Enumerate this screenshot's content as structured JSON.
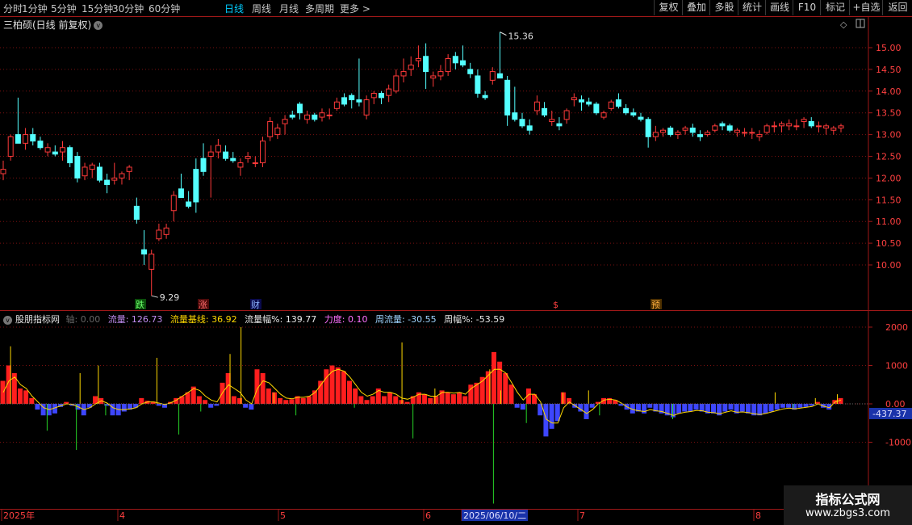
{
  "toolbar": {
    "left": [
      {
        "label": "分时",
        "active": false
      },
      {
        "label": "1分钟",
        "active": false
      },
      {
        "label": "5分钟",
        "active": false
      },
      {
        "label": "15分钟",
        "active": false
      },
      {
        "label": "30分钟",
        "active": false
      },
      {
        "label": "60分钟",
        "active": false
      },
      {
        "label": "日线",
        "active": true
      },
      {
        "label": "周线",
        "active": false
      },
      {
        "label": "月线",
        "active": false
      },
      {
        "label": "多周期",
        "active": false
      },
      {
        "label": "更多 >",
        "active": false
      }
    ],
    "right": [
      "复权",
      "叠加",
      "多股",
      "统计",
      "画线",
      "F10",
      "标记",
      "+自选",
      "返回"
    ]
  },
  "chart_title": "三柏硕(日线 前复权)",
  "price_axis": {
    "labels": [
      "15.00",
      "14.50",
      "14.00",
      "13.50",
      "13.00",
      "12.50",
      "12.00",
      "11.50",
      "11.00",
      "10.50",
      "10.00"
    ],
    "ylim": [
      9.29,
      15.36
    ]
  },
  "annotations": {
    "high": "15.36",
    "low": "9.29"
  },
  "event_markers": [
    "跌",
    "涨",
    "财",
    "$",
    "预"
  ],
  "indicator": {
    "name": "股朋指标网",
    "axis": {
      "label": "轴",
      "value": "0.00"
    },
    "flow": {
      "label": "流量",
      "value": "126.73"
    },
    "base": {
      "label": "流量基线",
      "value": "36.92"
    },
    "amp": {
      "label": "流量幅%",
      "value": "139.77"
    },
    "force": {
      "label": "力度",
      "value": "0.10"
    },
    "wflow": {
      "label": "周流量",
      "value": "-30.55"
    },
    "wamp": {
      "label": "周幅%",
      "value": "-53.59"
    },
    "axis_labels": [
      "2000",
      "1000",
      "0.00",
      "-1000"
    ],
    "current_value": "-437.37"
  },
  "date_axis": {
    "labels": [
      "2025年",
      "4",
      "5",
      "6",
      "2025/06/10/二",
      "7",
      "8"
    ]
  },
  "watermark": {
    "title": "指标公式网",
    "url": "www.zbgs3.com"
  },
  "colors": {
    "up": "#ff3a3a",
    "down": "#54ffff",
    "pos_bar": "#ff1e1e",
    "neg_bar": "#3d46ff",
    "grid": "#7a1010",
    "frame": "#a01818",
    "base_line": "#ffd900",
    "spike": "#27d227"
  },
  "chart_data": {
    "type": "candlestick",
    "price_ylim": [
      9.29,
      15.36
    ],
    "candles": [
      [
        12.1,
        12.4,
        11.95,
        12.2
      ],
      [
        12.5,
        13.0,
        12.4,
        12.95
      ],
      [
        13.0,
        13.85,
        12.8,
        12.8
      ],
      [
        12.8,
        13.15,
        12.65,
        13.0
      ],
      [
        13.0,
        13.15,
        12.75,
        12.85
      ],
      [
        12.85,
        12.95,
        12.65,
        12.7
      ],
      [
        12.6,
        12.8,
        12.5,
        12.7
      ],
      [
        12.6,
        12.75,
        12.5,
        12.55
      ],
      [
        12.6,
        12.85,
        12.4,
        12.7
      ],
      [
        12.7,
        12.75,
        12.25,
        12.35
      ],
      [
        12.5,
        12.6,
        11.9,
        12.0
      ],
      [
        12.05,
        12.35,
        11.95,
        12.25
      ],
      [
        12.2,
        12.35,
        12.0,
        12.3
      ],
      [
        12.25,
        12.35,
        11.9,
        11.95
      ],
      [
        11.95,
        12.1,
        11.65,
        11.85
      ],
      [
        11.95,
        12.35,
        11.85,
        12.0
      ],
      [
        12.0,
        12.15,
        11.85,
        12.1
      ],
      [
        12.15,
        12.3,
        11.95,
        12.25
      ],
      [
        11.35,
        11.55,
        10.95,
        11.05
      ],
      [
        10.35,
        10.8,
        10.0,
        10.25
      ],
      [
        9.9,
        10.35,
        9.29,
        10.25
      ],
      [
        10.6,
        10.95,
        10.55,
        10.8
      ],
      [
        10.7,
        10.95,
        10.6,
        10.85
      ],
      [
        11.25,
        11.7,
        11.0,
        11.6
      ],
      [
        11.75,
        12.1,
        11.6,
        11.55
      ],
      [
        11.45,
        11.7,
        11.3,
        11.35
      ],
      [
        12.2,
        12.45,
        11.2,
        11.45
      ],
      [
        12.45,
        12.8,
        12.05,
        12.15
      ],
      [
        12.5,
        12.75,
        11.55,
        12.6
      ],
      [
        12.6,
        12.9,
        12.45,
        12.75
      ],
      [
        12.6,
        12.75,
        12.4,
        12.45
      ],
      [
        12.45,
        12.6,
        12.35,
        12.4
      ],
      [
        12.25,
        12.45,
        12.05,
        12.35
      ],
      [
        12.45,
        12.6,
        12.35,
        12.5
      ],
      [
        12.35,
        12.5,
        12.25,
        12.35
      ],
      [
        12.35,
        12.95,
        12.25,
        12.85
      ],
      [
        12.95,
        13.4,
        12.85,
        13.3
      ],
      [
        13.0,
        13.25,
        12.9,
        13.15
      ],
      [
        13.25,
        13.45,
        13.0,
        13.35
      ],
      [
        13.45,
        13.55,
        13.35,
        13.4
      ],
      [
        13.7,
        13.75,
        13.35,
        13.5
      ],
      [
        13.35,
        13.55,
        13.25,
        13.45
      ],
      [
        13.45,
        13.5,
        13.3,
        13.35
      ],
      [
        13.4,
        13.6,
        13.3,
        13.5
      ],
      [
        13.45,
        13.6,
        13.35,
        13.45
      ],
      [
        13.6,
        13.85,
        13.55,
        13.75
      ],
      [
        13.85,
        13.95,
        13.65,
        13.7
      ],
      [
        13.9,
        13.95,
        13.6,
        13.8
      ],
      [
        13.8,
        14.75,
        13.65,
        13.75
      ],
      [
        13.45,
        13.9,
        13.35,
        13.8
      ],
      [
        13.85,
        14.0,
        13.7,
        13.95
      ],
      [
        13.95,
        14.0,
        13.7,
        13.85
      ],
      [
        13.9,
        14.15,
        13.75,
        14.05
      ],
      [
        14.0,
        14.5,
        13.95,
        14.35
      ],
      [
        14.35,
        14.75,
        14.2,
        14.45
      ],
      [
        14.5,
        14.8,
        14.35,
        14.6
      ],
      [
        14.7,
        15.05,
        14.55,
        14.75
      ],
      [
        14.8,
        15.1,
        14.05,
        14.45
      ],
      [
        14.3,
        14.45,
        14.1,
        14.35
      ],
      [
        14.35,
        14.6,
        14.25,
        14.45
      ],
      [
        14.45,
        14.85,
        14.35,
        14.75
      ],
      [
        14.8,
        14.9,
        14.5,
        14.65
      ],
      [
        14.7,
        15.05,
        14.55,
        14.6
      ],
      [
        14.5,
        14.65,
        14.3,
        14.4
      ],
      [
        14.35,
        14.5,
        13.85,
        13.95
      ],
      [
        13.9,
        14.0,
        13.8,
        13.85
      ],
      [
        14.25,
        14.55,
        14.15,
        14.45
      ],
      [
        14.4,
        15.36,
        14.3,
        14.3
      ],
      [
        14.25,
        14.35,
        13.2,
        13.45
      ],
      [
        13.5,
        14.1,
        13.3,
        13.35
      ],
      [
        13.35,
        13.5,
        13.15,
        13.2
      ],
      [
        13.2,
        13.35,
        13.0,
        13.1
      ],
      [
        13.55,
        13.9,
        13.45,
        13.75
      ],
      [
        13.6,
        13.75,
        13.4,
        13.45
      ],
      [
        13.3,
        13.55,
        13.2,
        13.35
      ],
      [
        13.25,
        13.4,
        13.1,
        13.2
      ],
      [
        13.35,
        13.6,
        13.25,
        13.55
      ],
      [
        13.8,
        13.95,
        13.65,
        13.85
      ],
      [
        13.8,
        13.9,
        13.55,
        13.75
      ],
      [
        13.75,
        13.85,
        13.65,
        13.7
      ],
      [
        13.7,
        13.75,
        13.45,
        13.5
      ],
      [
        13.4,
        13.55,
        13.35,
        13.5
      ],
      [
        13.6,
        13.8,
        13.55,
        13.75
      ],
      [
        13.8,
        13.95,
        13.6,
        13.65
      ],
      [
        13.6,
        13.7,
        13.45,
        13.5
      ],
      [
        13.5,
        13.6,
        13.4,
        13.45
      ],
      [
        13.4,
        13.5,
        13.3,
        13.35
      ],
      [
        13.35,
        13.4,
        12.7,
        12.95
      ],
      [
        12.95,
        13.2,
        12.85,
        13.05
      ],
      [
        13.05,
        13.15,
        12.95,
        13.1
      ],
      [
        13.15,
        13.2,
        12.95,
        13.0
      ],
      [
        13.0,
        13.1,
        12.9,
        13.05
      ],
      [
        13.1,
        13.2,
        13.0,
        13.15
      ],
      [
        13.15,
        13.25,
        12.95,
        13.05
      ],
      [
        13.0,
        13.1,
        12.85,
        12.95
      ],
      [
        13.0,
        13.1,
        12.95,
        13.05
      ],
      [
        13.1,
        13.25,
        13.05,
        13.2
      ],
      [
        13.25,
        13.3,
        13.1,
        13.2
      ],
      [
        13.2,
        13.25,
        13.05,
        13.1
      ],
      [
        13.05,
        13.15,
        12.95,
        13.1
      ],
      [
        13.05,
        13.15,
        12.95,
        13.05
      ],
      [
        13.05,
        13.15,
        12.9,
        13.05
      ],
      [
        12.95,
        13.1,
        12.85,
        13.0
      ],
      [
        13.05,
        13.25,
        13.0,
        13.2
      ],
      [
        13.2,
        13.3,
        13.05,
        13.2
      ],
      [
        13.2,
        13.3,
        13.05,
        13.25
      ],
      [
        13.2,
        13.35,
        13.1,
        13.25
      ],
      [
        13.2,
        13.35,
        13.1,
        13.2
      ],
      [
        13.3,
        13.4,
        13.15,
        13.35
      ],
      [
        13.3,
        13.4,
        13.15,
        13.2
      ],
      [
        13.2,
        13.3,
        13.05,
        13.2
      ],
      [
        13.15,
        13.25,
        13.0,
        13.2
      ],
      [
        13.1,
        13.2,
        13.0,
        13.15
      ],
      [
        13.15,
        13.25,
        13.05,
        13.2
      ]
    ],
    "flow_ylim": [
      -2500,
      2500
    ],
    "flow_bars": [
      600,
      1000,
      800,
      400,
      350,
      150,
      -150,
      -300,
      -300,
      -250,
      -80,
      50,
      -50,
      -150,
      -300,
      -100,
      200,
      150,
      -50,
      -300,
      -300,
      -200,
      -150,
      -100,
      150,
      80,
      60,
      -50,
      -100,
      50,
      150,
      200,
      300,
      450,
      200,
      100,
      -100,
      -50,
      550,
      800,
      200,
      150,
      -100,
      -150,
      900,
      800,
      400,
      300,
      150,
      100,
      120,
      200,
      150,
      200,
      350,
      600,
      900,
      1000,
      950,
      850,
      600,
      400,
      200,
      100,
      200,
      400,
      200,
      300,
      200,
      100,
      50,
      200,
      300,
      250,
      150,
      200,
      350,
      300,
      250,
      300,
      200,
      500,
      550,
      700,
      850,
      1350,
      1100,
      800,
      500,
      -100,
      -150,
      400,
      250,
      -300,
      -850,
      -650,
      -450,
      300,
      150,
      -100,
      -200,
      -400,
      -100,
      50,
      150,
      150,
      100,
      -50,
      -150,
      -250,
      -200,
      -250,
      -100,
      -200,
      -250,
      -300,
      -350,
      -250,
      -200,
      -200,
      -150,
      -200,
      -250,
      -250,
      -300,
      -200,
      -150,
      -250,
      -200,
      -250,
      -300,
      -300,
      -250,
      -200,
      -150,
      -100,
      -100,
      -150,
      -100,
      -80,
      -50,
      50,
      -100,
      -150,
      100,
      150
    ],
    "base_line": [
      300,
      600,
      700,
      500,
      400,
      200,
      50,
      -100,
      -150,
      -100,
      -50,
      0,
      -20,
      -80,
      -150,
      -100,
      0,
      80,
      20,
      -100,
      -150,
      -150,
      -130,
      -100,
      0,
      50,
      50,
      20,
      -20,
      30,
      100,
      200,
      300,
      400,
      350,
      200,
      100,
      50,
      300,
      500,
      400,
      300,
      100,
      0,
      400,
      600,
      550,
      400,
      250,
      150,
      130,
      170,
      170,
      200,
      300,
      500,
      700,
      850,
      900,
      850,
      700,
      500,
      300,
      200,
      250,
      350,
      300,
      300,
      250,
      150,
      120,
      180,
      250,
      250,
      200,
      200,
      300,
      300,
      280,
      300,
      250,
      400,
      500,
      600,
      750,
      900,
      900,
      800,
      550,
      300,
      100,
      250,
      250,
      50,
      -400,
      -500,
      -500,
      -100,
      50,
      -50,
      -150,
      -250,
      -150,
      0,
      100,
      120,
      100,
      20,
      -80,
      -150,
      -180,
      -200,
      -150,
      -180,
      -200,
      -250,
      -300,
      -250,
      -220,
      -200,
      -170,
      -180,
      -220,
      -230,
      -260,
      -220,
      -180,
      -220,
      -210,
      -230,
      -260,
      -280,
      -250,
      -210,
      -170,
      -130,
      -110,
      -130,
      -110,
      -90,
      -70,
      0,
      -60,
      -100,
      50,
      100
    ],
    "spikes": [
      [
        2,
        1500
      ],
      [
        12,
        -700
      ],
      [
        20,
        -1200
      ],
      [
        21,
        800
      ],
      [
        26,
        1000
      ],
      [
        28,
        -300
      ],
      [
        42,
        1200
      ],
      [
        48,
        -800
      ],
      [
        54,
        -200
      ],
      [
        62,
        1300
      ],
      [
        65,
        2000
      ],
      [
        74,
        300
      ],
      [
        80,
        -300
      ],
      [
        96,
        -100
      ],
      [
        109,
        1600
      ],
      [
        112,
        -900
      ],
      [
        118,
        400
      ],
      [
        133,
        900
      ],
      [
        134,
        -2600
      ],
      [
        136,
        350
      ],
      [
        143,
        -500
      ],
      [
        153,
        300
      ],
      [
        160,
        350
      ],
      [
        163,
        -300
      ],
      [
        183,
        -400
      ],
      [
        211,
        300
      ],
      [
        216,
        -100
      ],
      [
        222,
        150
      ],
      [
        228,
        250
      ]
    ]
  }
}
